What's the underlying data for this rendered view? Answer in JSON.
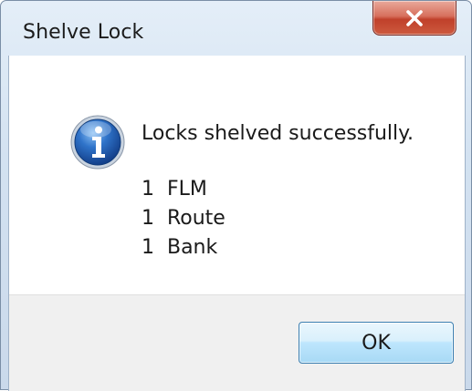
{
  "window": {
    "title": "Shelve Lock",
    "close_icon": "close-icon"
  },
  "dialog": {
    "icon": "information-icon",
    "message": "Locks shelved successfully.",
    "details": [
      "1  FLM",
      "1  Route",
      "1  Bank"
    ],
    "ok_label": "OK"
  },
  "colors": {
    "close_button": "#c7442c",
    "ok_button_border": "#3c7fb1",
    "info_icon": "#1f5fb4",
    "footer_background": "#f0f0f0"
  }
}
